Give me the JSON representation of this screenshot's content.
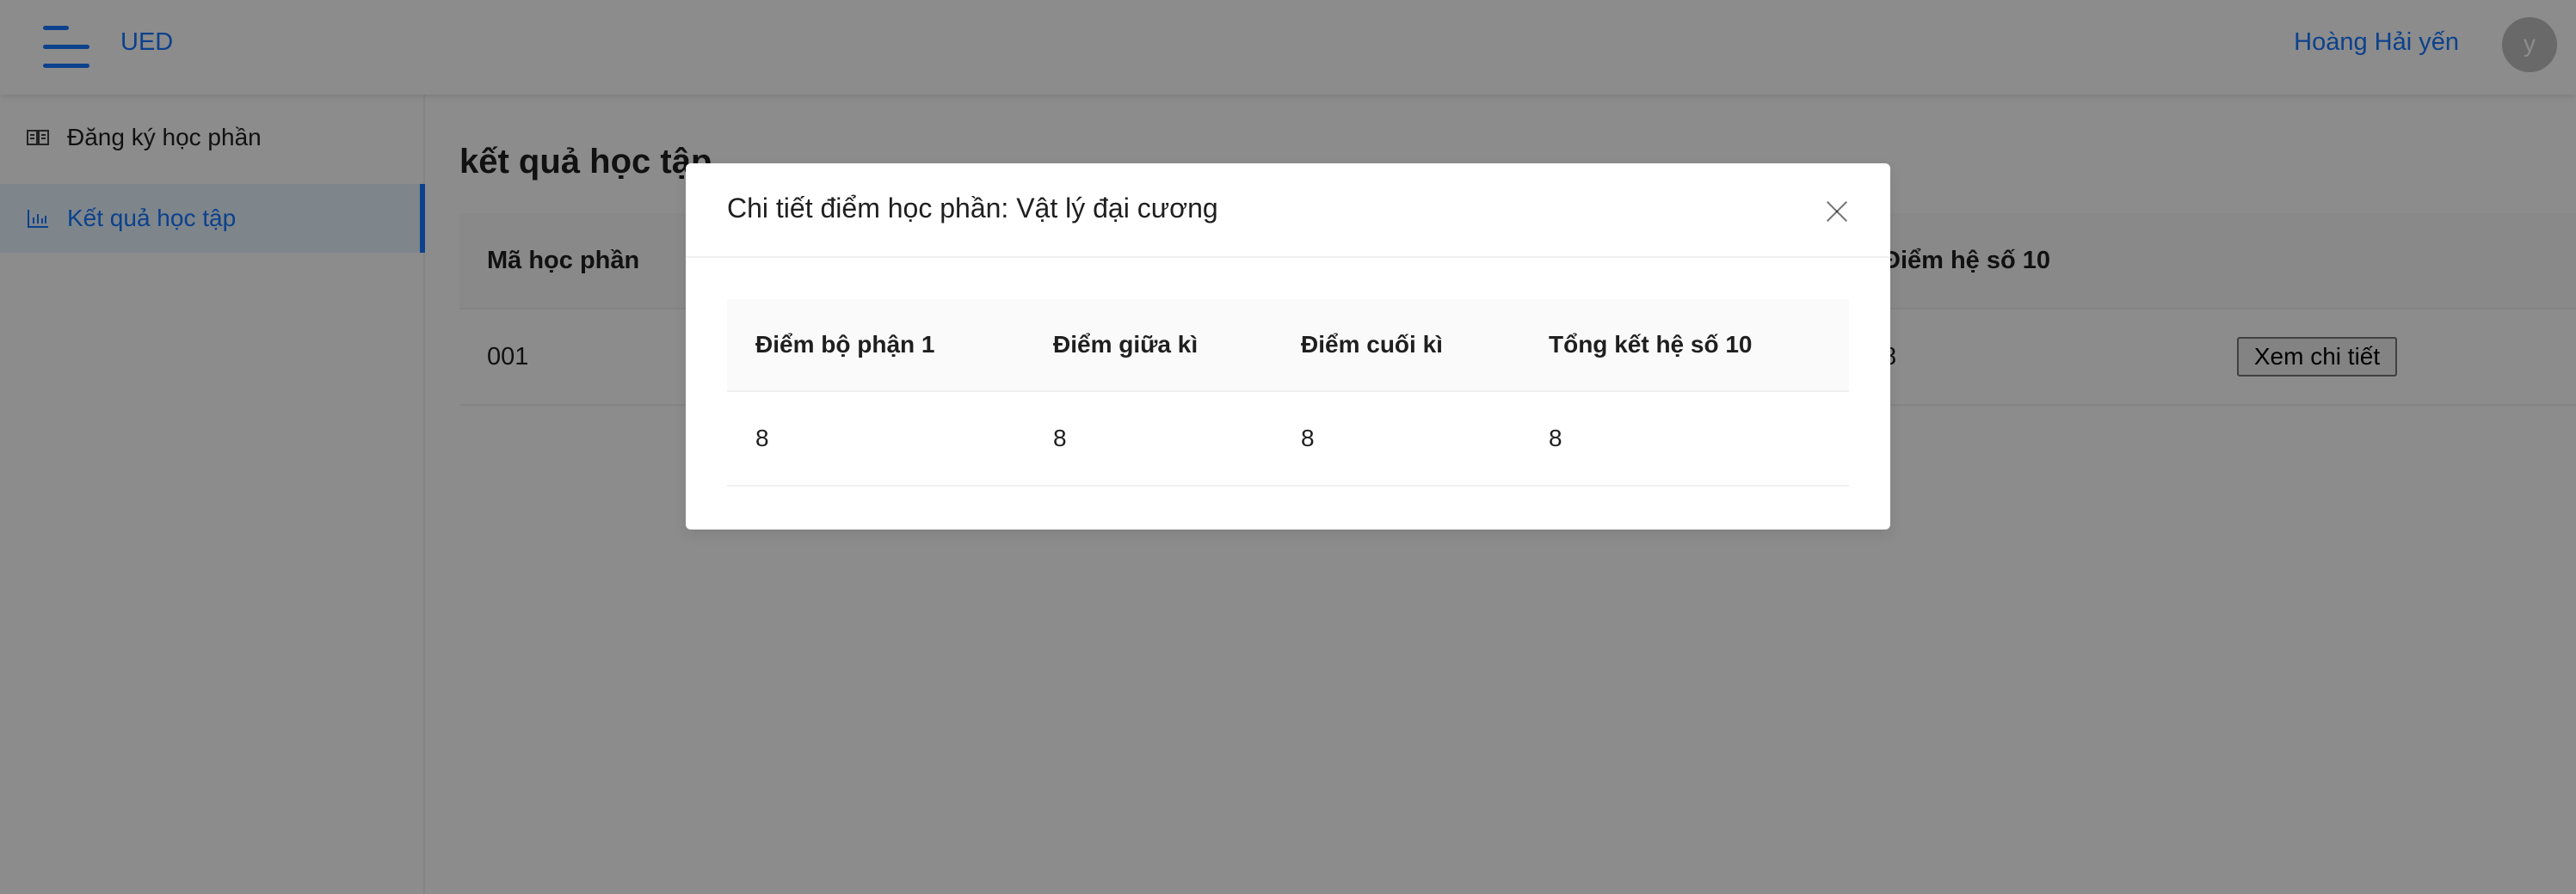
{
  "header": {
    "logo": "UED",
    "user_name": "Hoàng Hải yến",
    "avatar_letter": "y"
  },
  "sidebar": {
    "items": [
      {
        "label": "Đăng ký học phần",
        "icon": "book-icon",
        "active": false
      },
      {
        "label": "Kết quả học tập",
        "icon": "bar-chart-icon",
        "active": true
      }
    ]
  },
  "main": {
    "title": "kết quả học tập",
    "table": {
      "columns": [
        "Mã học phần",
        "Điểm hệ số 10"
      ],
      "rows": [
        {
          "ma_hoc_phan": "001",
          "diem_he_so_10": "8",
          "action_label": "Xem chi tiết"
        }
      ]
    }
  },
  "modal": {
    "title": "Chi tiết điểm học phần: Vật lý đại cương",
    "columns": [
      "Điểm bộ phận 1",
      "Điểm giữa kì",
      "Điểm cuối kì",
      "Tổng kết hệ số 10"
    ],
    "rows": [
      [
        "8",
        "8",
        "8",
        "8"
      ]
    ]
  },
  "colors": {
    "accent": "#1677ff",
    "mask": "rgba(0,0,0,0.45)"
  }
}
